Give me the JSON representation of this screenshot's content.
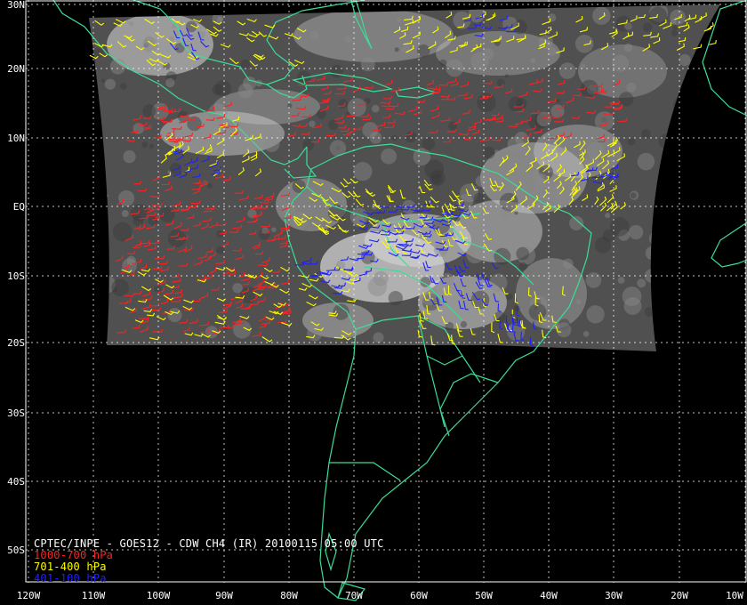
{
  "caption": {
    "title": "CPTEC/INPE - GOES12 - CDW CH4 (IR) 20100115 05:00 UTC",
    "legend": [
      {
        "label": "1000-700 hPa",
        "color": "#ff2020"
      },
      {
        "label": "701-400 hPa",
        "color": "#ffff00"
      },
      {
        "label": "401-100 hPa",
        "color": "#2020ff"
      }
    ]
  },
  "latitude_labels": [
    "30N",
    "20N",
    "10N",
    "EQ",
    "10S",
    "20S",
    "30S",
    "40S",
    "50S"
  ],
  "longitude_labels": [
    "120W",
    "110W",
    "100W",
    "90W",
    "80W",
    "70W",
    "60W",
    "50W",
    "40W",
    "30W",
    "20W",
    "10W"
  ],
  "colors": {
    "background": "#000000",
    "coastline": "#3ddc97",
    "grid": "#ffffff",
    "ir_imagery": "#5a5a5a"
  }
}
